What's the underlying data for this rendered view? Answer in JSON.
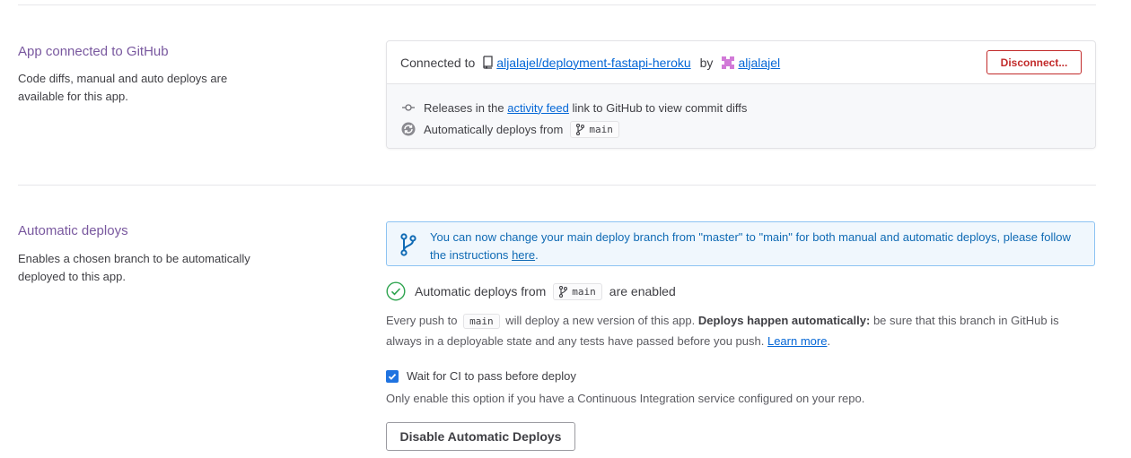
{
  "github_section": {
    "title": "App connected to GitHub",
    "description": "Code diffs, manual and auto deploys are available for this app.",
    "card": {
      "connected_to_label": "Connected to",
      "repo_name": "aljalajel/deployment-fastapi-heroku",
      "by_label": "by",
      "user_name": "aljalajel",
      "disconnect_label": "Disconnect...",
      "releases_prefix": "Releases in the",
      "activity_feed_link": "activity feed",
      "releases_suffix": "link to GitHub to view commit diffs",
      "auto_deploys_label": "Automatically deploys from",
      "branch": "main"
    }
  },
  "auto_deploy_section": {
    "title": "Automatic deploys",
    "description": "Enables a chosen branch to be automatically deployed to this app.",
    "banner": {
      "text": "You can now change your main deploy branch from \"master\" to \"main\" for both manual and automatic deploys, please follow the instructions",
      "link": "here",
      "suffix": "."
    },
    "enabled": {
      "prefix": "Automatic deploys from",
      "branch": "main",
      "suffix": "are enabled"
    },
    "paragraph": {
      "prefix": "Every push to",
      "branch": "main",
      "middle": "will deploy a new version of this app.",
      "bold": "Deploys happen automatically:",
      "rest": "be sure that this branch in GitHub is always in a deployable state and any tests have passed before you push.",
      "learn_more": "Learn more",
      "end": "."
    },
    "ci_checkbox": {
      "label": "Wait for CI to pass before deploy",
      "checked": true,
      "hint": "Only enable this option if you have a Continuous Integration service configured on your repo."
    },
    "disable_button": "Disable Automatic Deploys"
  },
  "colors": {
    "section_title": "#79589f",
    "link": "#0366d6",
    "danger": "#c22b2b",
    "info_border": "#8dc3f2",
    "info_bg": "#f0f7fd",
    "info_text": "#0f6ab4",
    "success": "#2ea44f",
    "checkbox": "#1f73e0"
  }
}
